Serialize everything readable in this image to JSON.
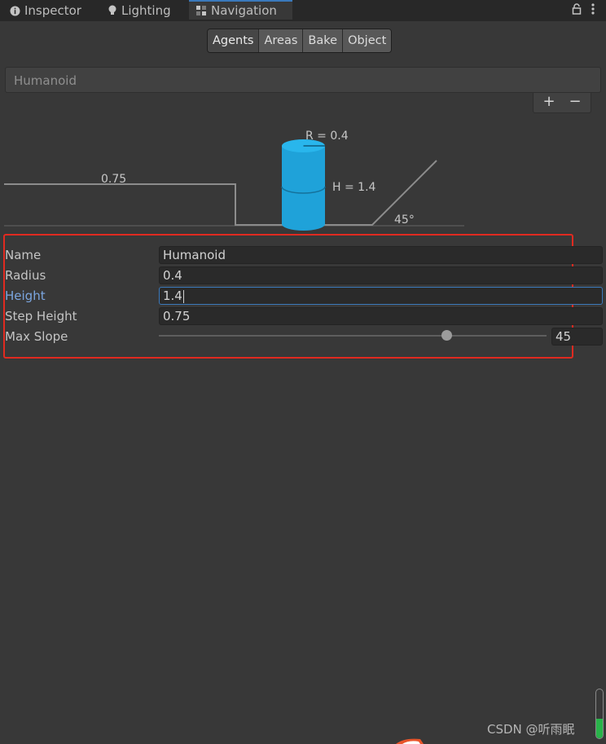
{
  "tabs": [
    {
      "label": "Inspector",
      "icon": "info-icon"
    },
    {
      "label": "Lighting",
      "icon": "bulb-icon"
    },
    {
      "label": "Navigation",
      "icon": "navmesh-icon",
      "active": true
    }
  ],
  "segments": [
    "Agents",
    "Areas",
    "Bake",
    "Object"
  ],
  "agent_list": {
    "items": [
      "Humanoid"
    ],
    "add_label": "+",
    "remove_label": "−"
  },
  "diagram": {
    "step_label": "0.75",
    "radius_label": "R = 0.4",
    "height_label": "H = 1.4",
    "slope_label": "45°"
  },
  "form": {
    "name": {
      "label": "Name",
      "value": "Humanoid"
    },
    "radius": {
      "label": "Radius",
      "value": "0.4"
    },
    "height": {
      "label": "Height",
      "value": "1.4"
    },
    "step_height": {
      "label": "Step Height",
      "value": "0.75"
    },
    "max_slope": {
      "label": "Max Slope",
      "value": "45"
    }
  },
  "watermark": "CSDN @听雨眠",
  "colors": {
    "accent": "#3a79bb",
    "highlight": "#e02a20",
    "agent": "#1fa2d9"
  }
}
